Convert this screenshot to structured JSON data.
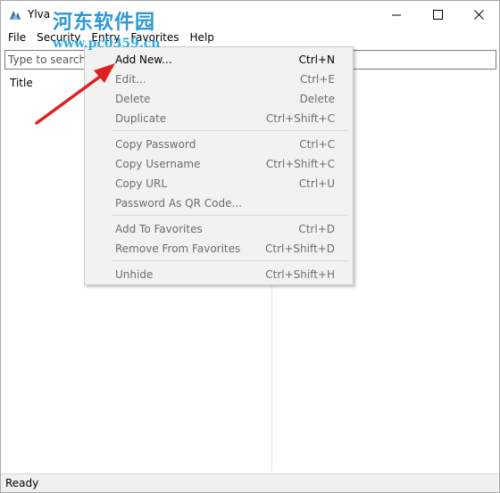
{
  "window": {
    "title": "Ylva",
    "watermark": "河东软件园",
    "watermark_url": "www.pc0359.cn"
  },
  "menubar": {
    "items": [
      {
        "label": "File"
      },
      {
        "label": "Security"
      },
      {
        "label": "Entry"
      },
      {
        "label": "Favorites"
      },
      {
        "label": "Help"
      }
    ]
  },
  "search": {
    "placeholder": "Type to search"
  },
  "list": {
    "column_title": "Title"
  },
  "status": {
    "text": "Ready"
  },
  "entry_menu": {
    "items": [
      {
        "label": "Add New...",
        "shortcut": "Ctrl+N",
        "enabled": true
      },
      {
        "label": "Edit...",
        "shortcut": "Ctrl+E",
        "enabled": false
      },
      {
        "label": "Delete",
        "shortcut": "Delete",
        "enabled": false
      },
      {
        "label": "Duplicate",
        "shortcut": "Ctrl+Shift+C",
        "enabled": false
      },
      {
        "label": "Copy Password",
        "shortcut": "Ctrl+C",
        "enabled": false
      },
      {
        "label": "Copy Username",
        "shortcut": "Ctrl+Shift+C",
        "enabled": false
      },
      {
        "label": "Copy URL",
        "shortcut": "Ctrl+U",
        "enabled": false
      },
      {
        "label": "Password As QR Code...",
        "shortcut": "",
        "enabled": false
      },
      {
        "label": "Add To Favorites",
        "shortcut": "Ctrl+D",
        "enabled": false
      },
      {
        "label": "Remove From Favorites",
        "shortcut": "Ctrl+Shift+D",
        "enabled": false
      },
      {
        "label": "Unhide",
        "shortcut": "Ctrl+Shift+H",
        "enabled": false
      }
    ]
  },
  "colors": {
    "arrow": "#e02020",
    "watermark": "#1b8fd4",
    "menu_bg": "#f2f2f2",
    "disabled_text": "#6d6d6d"
  }
}
